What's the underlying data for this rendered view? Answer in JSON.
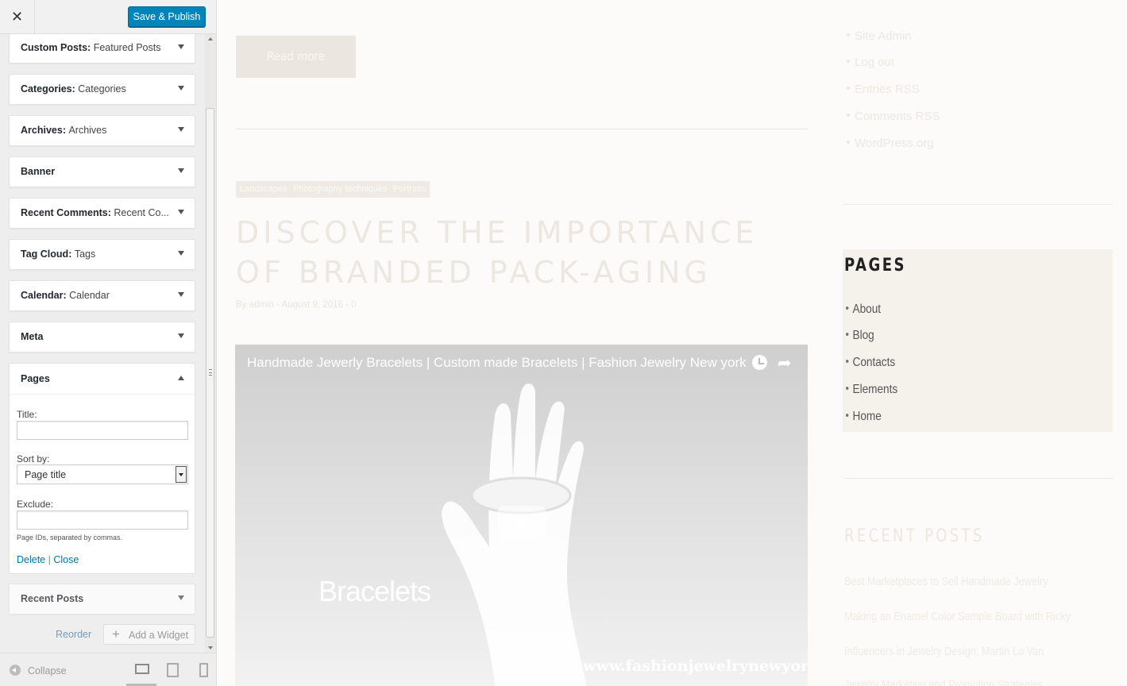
{
  "customizer": {
    "close_label": "✕",
    "publish_label": "Save & Publish",
    "widgets": [
      {
        "title": "Custom Posts",
        "sub": "Featured Posts"
      },
      {
        "title": "Categories",
        "sub": "Categories"
      },
      {
        "title": "Archives",
        "sub": "Archives"
      },
      {
        "title": "Banner",
        "sub": ""
      },
      {
        "title": "Recent Comments",
        "sub": "Recent Co..."
      },
      {
        "title": "Tag Cloud",
        "sub": "Tags"
      },
      {
        "title": "Calendar",
        "sub": "Calendar"
      },
      {
        "title": "Meta",
        "sub": ""
      }
    ],
    "pages_widget": {
      "title": "Pages",
      "title_label": "Title:",
      "title_value": "",
      "sort_label": "Sort by:",
      "sort_value": "Page title",
      "exclude_label": "Exclude:",
      "exclude_value": "",
      "hint": "Page IDs, separated by commas.",
      "delete_label": "Delete",
      "separator": "|",
      "close_label": "Close"
    },
    "recent_posts_widget": "Recent Posts",
    "reorder_label": "Reorder",
    "add_widget_label": "Add a Widget",
    "collapse_label": "Collapse"
  },
  "preview": {
    "read_more": "Read more",
    "tags": [
      "Landscapes",
      "Photography techniques",
      "Portraits"
    ],
    "post_title": "DISCOVER THE IMPORTANCE OF BRANDED PACK-AGING",
    "post_meta": "By admin - August 9, 2016 - 0",
    "video": {
      "title": "Handmade Jewerly Bracelets | Custom made Bracelets | Fashion Jewelry New york",
      "overlay_word": "Bracelets",
      "overlay_url": "www.fashionjewelrynewyork.com"
    },
    "meta_links": [
      "Site Admin",
      "Log out",
      "Entries RSS",
      "Comments RSS",
      "WordPress.org"
    ],
    "pages_heading": "PAGES",
    "pages_links": [
      "About",
      "Blog",
      "Contacts",
      "Elements",
      "Home"
    ],
    "recent_heading": "RECENT POSTS",
    "recent_posts": [
      "Best Marketplaces to Sell Handmade Jewelry",
      "Making an Enamel Color Sample Board with Ricky",
      "Influencers in Jewelry Design: Martin Lo Van",
      "Jewelry Marketing and Promotion Strategies"
    ]
  },
  "colors": {
    "publish": "#0085ba",
    "link": "#0073aa",
    "pages_block_bg": "#f5f2ec"
  }
}
